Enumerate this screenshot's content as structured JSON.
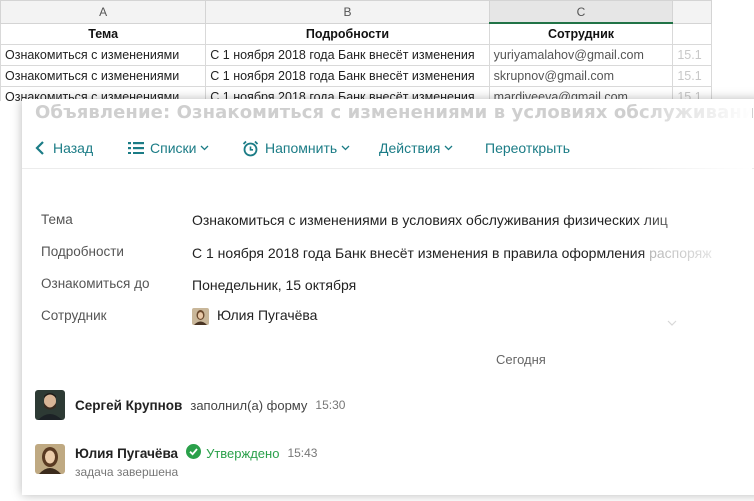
{
  "sheet": {
    "columns": [
      "A",
      "B",
      "C"
    ],
    "headers": [
      "Тема",
      "Подробности",
      "Сотрудник"
    ],
    "rows": [
      {
        "a": "Ознакомиться с изменениями",
        "b": "С 1 ноября 2018 года Банк внесёт изменения",
        "c": "yuriyamalahov@gmail.com",
        "d": "15.1"
      },
      {
        "a": "Ознакомиться с изменениями",
        "b": "С 1 ноября 2018 года Банк внесёт изменения",
        "c": "skrupnov@gmail.com",
        "d": "15.1"
      },
      {
        "a": "Ознакомиться с изменениями",
        "b": "С 1 ноября 2018 года Банк внесёт изменения",
        "c": "mardiveeva@gmail.com",
        "d": "15.1"
      }
    ]
  },
  "card": {
    "title": "Объявление: Ознакомиться с изменениями в условиях обслуживания физических лиц"
  },
  "toolbar": {
    "back": "Назад",
    "lists": "Списки",
    "remind": "Напомнить",
    "actions": "Действия",
    "reopen": "Переоткрыть"
  },
  "fields": {
    "topic_label": "Тема",
    "topic_value": "Ознакомиться с изменениями в условиях обслуживания физических лиц",
    "details_label": "Подробности",
    "details_value": "С 1 ноября 2018 года Банк внесёт изменения в правила оформления ",
    "details_tail": "распоряж",
    "due_label": "Ознакомиться до",
    "due_value": "Понедельник, 15 октября",
    "employee_label": "Сотрудник",
    "employee_value": "Юлия Пугачёва"
  },
  "feed": {
    "day": "Сегодня",
    "items": [
      {
        "name": "Сергей Крупнов",
        "action": "заполнил(а) форму",
        "time": "15:30"
      },
      {
        "name": "Юлия Пугачёва",
        "status": "Утверждено",
        "time": "15:43",
        "note": "задача завершена"
      }
    ]
  },
  "colors": {
    "accent": "#1b7c86",
    "approved": "#2aa04a",
    "title_faded": "#cfcfcf"
  },
  "icons": [
    "chevron-left-icon",
    "list-icon",
    "alarm-clock-icon",
    "chevron-down-icon",
    "check-circle-icon"
  ]
}
